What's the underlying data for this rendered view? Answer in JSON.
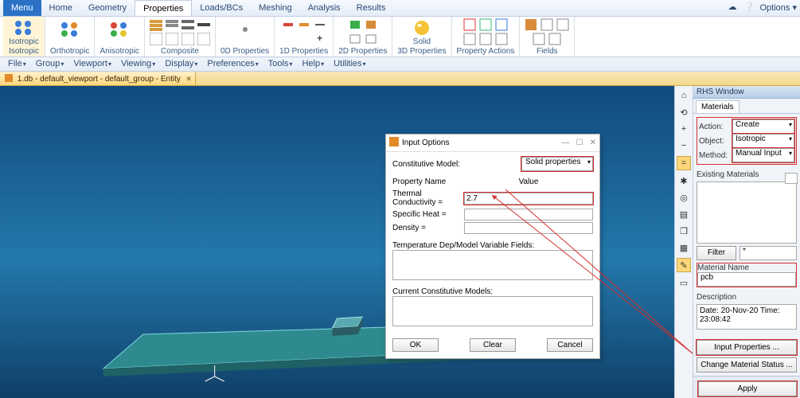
{
  "menu": {
    "main": "Menu",
    "items": [
      "Home",
      "Geometry",
      "Properties",
      "Loads/BCs",
      "Meshing",
      "Analysis",
      "Results"
    ],
    "active_index": 2,
    "options": "Options"
  },
  "ribbon": {
    "groups": [
      {
        "label": "Isotropic"
      },
      {
        "label": "Orthotropic"
      },
      {
        "label": "Anisotropic"
      },
      {
        "label": "Composite"
      },
      {
        "label": "0D Properties"
      },
      {
        "label": "1D Properties"
      },
      {
        "label": "2D Properties"
      },
      {
        "label": "3D Properties"
      },
      {
        "label": "Property Actions"
      },
      {
        "label": "Fields"
      }
    ],
    "isotropic_label": "Isotropic",
    "solid_label": "Solid"
  },
  "menubar2": {
    "items": [
      "File",
      "Group",
      "Viewport",
      "Viewing",
      "Display",
      "Preferences",
      "Tools",
      "Help",
      "Utilities"
    ]
  },
  "tab": {
    "title": "1.db - default_viewport - default_group - Entity"
  },
  "rhs": {
    "title": "RHS Window",
    "tab": "Materials",
    "action_label": "Action:",
    "action_value": "Create",
    "object_label": "Object:",
    "object_value": "Isotropic",
    "method_label": "Method:",
    "method_value": "Manual Input",
    "existing_label": "Existing Materials",
    "filter_btn": "Filter",
    "filter_value": "*",
    "matname_label": "Material Name",
    "matname_value": "pcb",
    "desc_label": "Description",
    "desc_value": "Date: 20-Nov-20       Time: 23:08:42",
    "input_props_btn": "Input Properties ...",
    "change_status_btn": "Change Material Status ...",
    "apply_btn": "Apply"
  },
  "dialog": {
    "title": "Input Options",
    "const_model_label": "Constitutive Model:",
    "const_model_value": "Solid properties",
    "col_property": "Property Name",
    "col_value": "Value",
    "props": [
      {
        "name": "Thermal Conductivity =",
        "value": "2.7",
        "hl": true
      },
      {
        "name": "Specific Heat =",
        "value": "",
        "hl": false
      },
      {
        "name": "Density =",
        "value": "",
        "hl": false
      }
    ],
    "temp_dep_label": "Temperature Dep/Model Variable Fields:",
    "curr_models_label": "Current Constitutive Models:",
    "ok_btn": "OK",
    "clear_btn": "Clear",
    "cancel_btn": "Cancel"
  }
}
